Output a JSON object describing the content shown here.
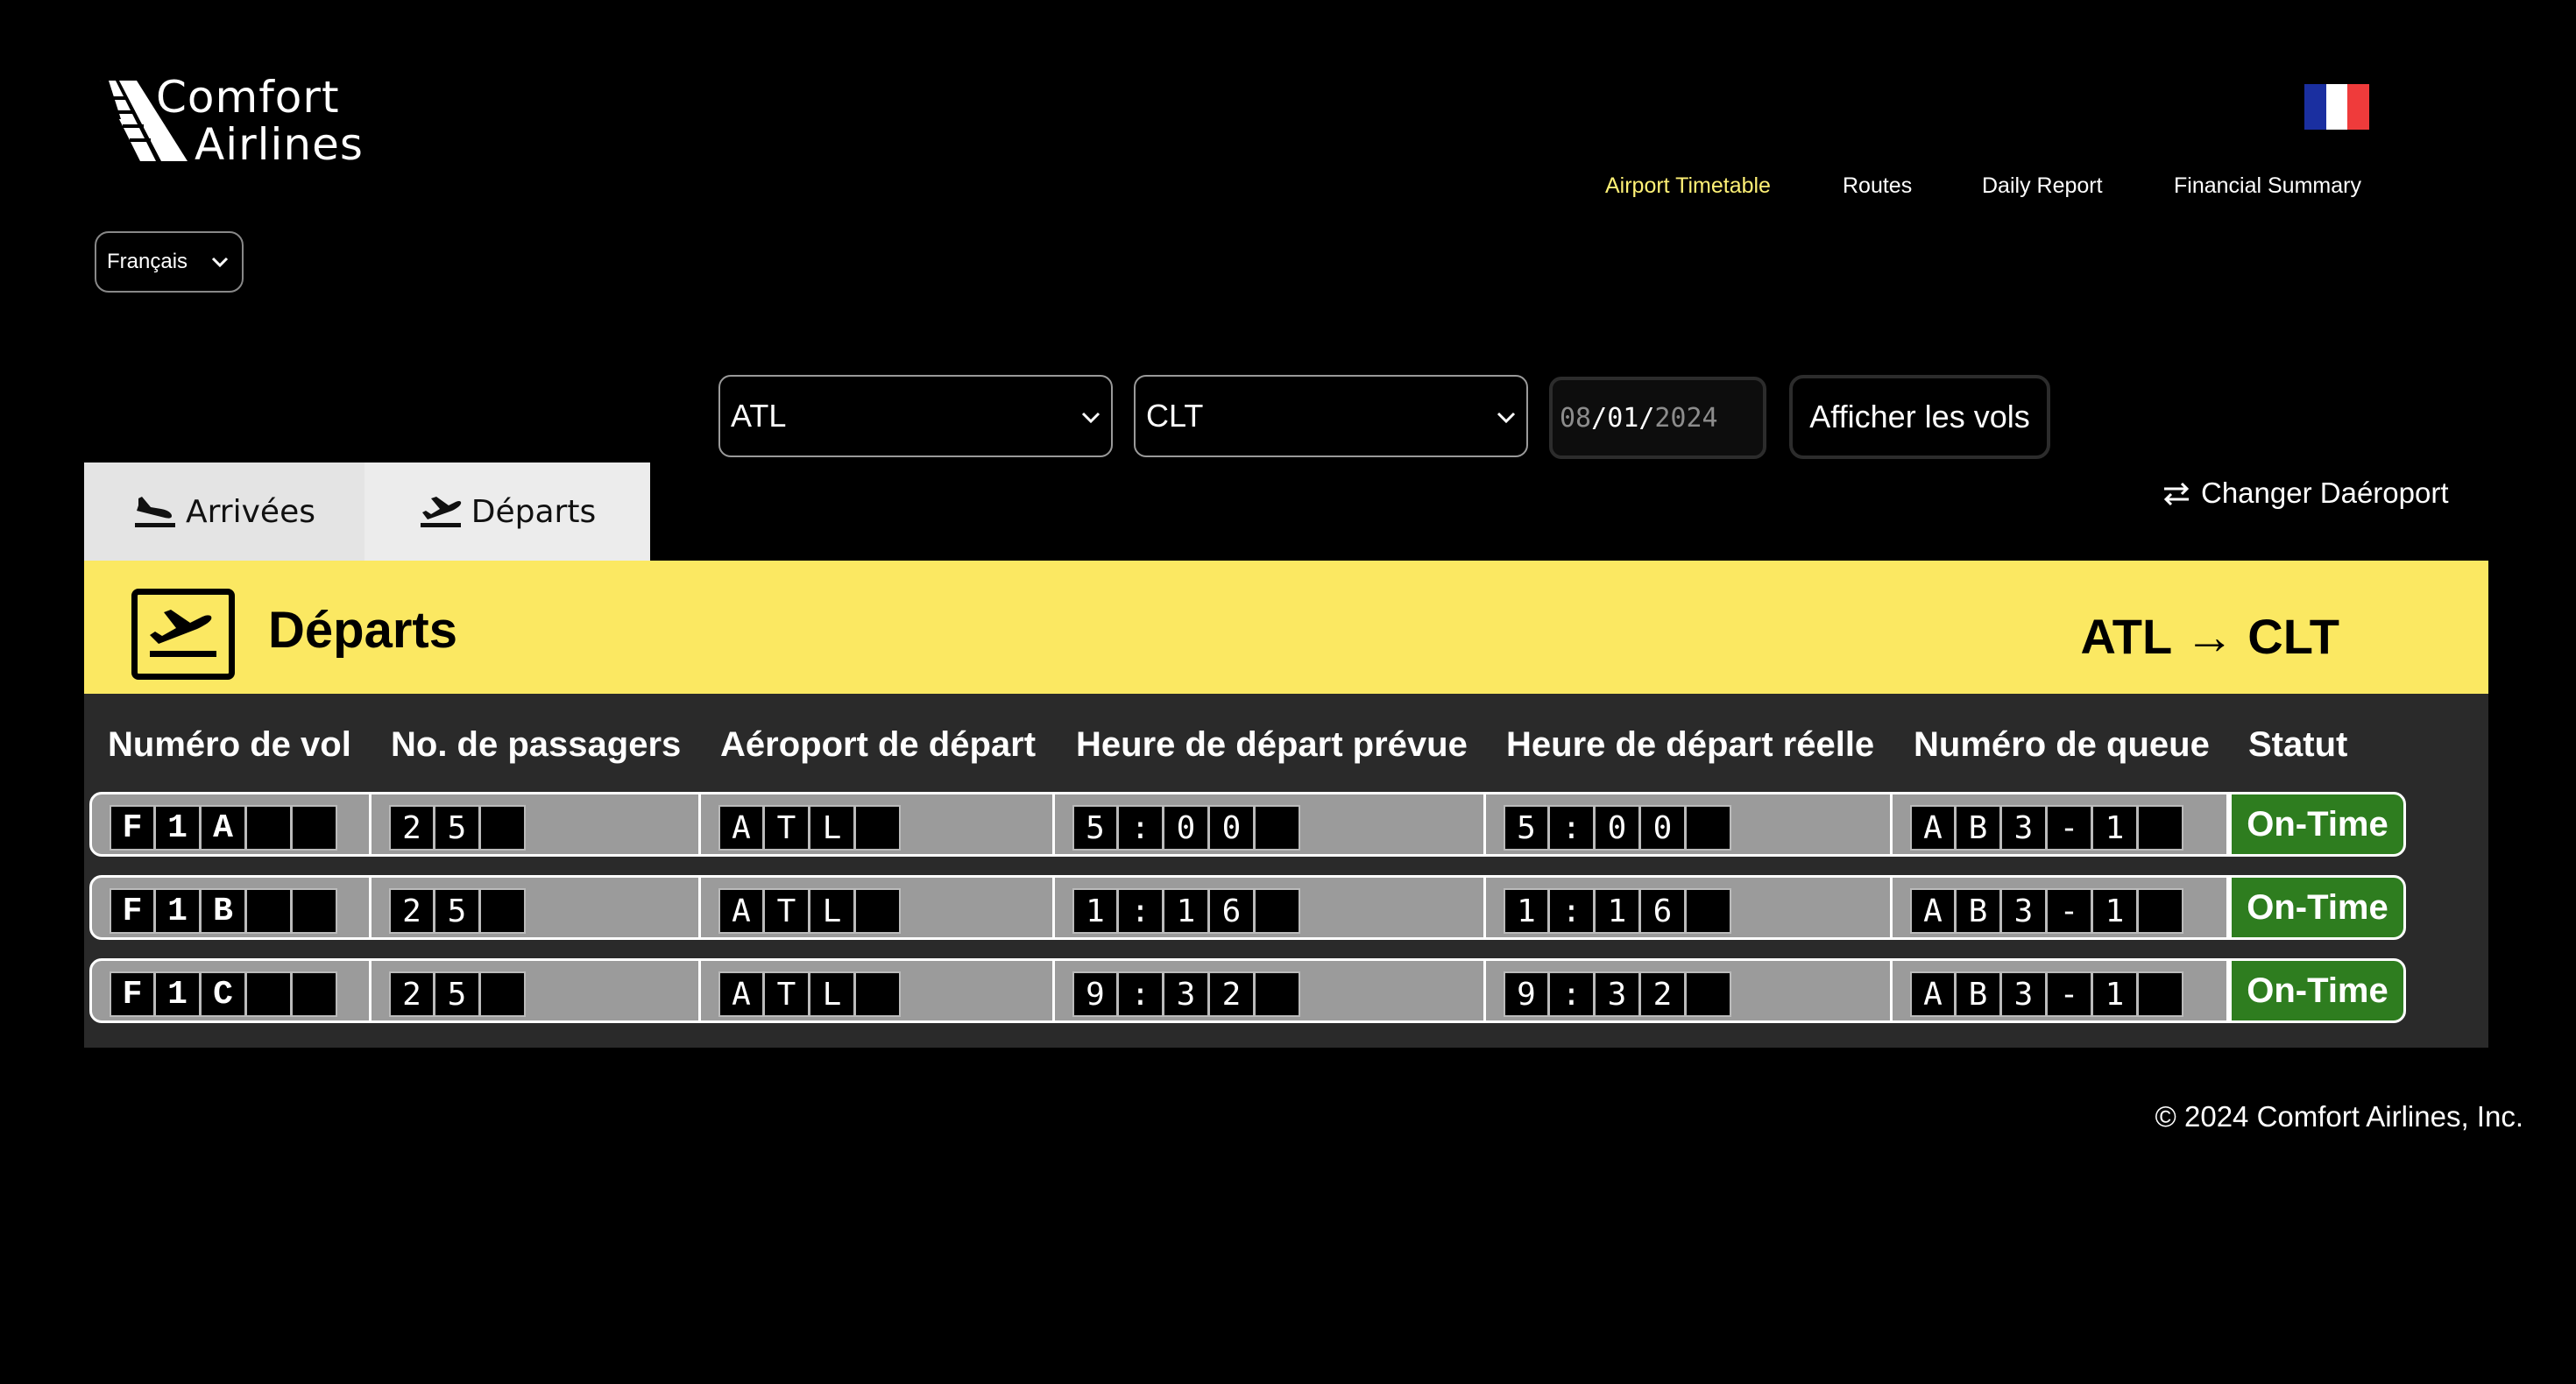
{
  "brand": {
    "line1": "Comfort",
    "line2": "Airlines"
  },
  "nav": {
    "items": [
      {
        "label": "Airport Timetable",
        "active": true
      },
      {
        "label": "Routes",
        "active": false
      },
      {
        "label": "Daily Report",
        "active": false
      },
      {
        "label": "Financial Summary",
        "active": false
      }
    ]
  },
  "language": {
    "value": "Français"
  },
  "filters": {
    "origin": "ATL",
    "destination": "CLT",
    "date_month": "08",
    "date_day": "01",
    "date_year": "2024",
    "submit_label": "Afficher les vols"
  },
  "tabs": {
    "arrivals": "Arrivées",
    "departures": "Départs"
  },
  "change_airport": "Changer Daéroport",
  "board": {
    "title": "Départs",
    "route_from": "ATL",
    "route_arrow": "→",
    "route_to": "CLT",
    "columns": [
      "Numéro de vol",
      "No. de passagers",
      "Aéroport de départ",
      "Heure de départ prévue",
      "Heure de départ réelle",
      "Numéro de queue",
      "Statut"
    ],
    "rows": [
      {
        "flight": "F1A",
        "passengers": "25",
        "airport": "ATL",
        "scheduled": "5:00",
        "actual": "5:00",
        "tail": "AB3-1",
        "status": "On-Time"
      },
      {
        "flight": "F1B",
        "passengers": "25",
        "airport": "ATL",
        "scheduled": "1:16",
        "actual": "1:16",
        "tail": "AB3-1",
        "status": "On-Time"
      },
      {
        "flight": "F1C",
        "passengers": "25",
        "airport": "ATL",
        "scheduled": "9:32",
        "actual": "9:32",
        "tail": "AB3-1",
        "status": "On-Time"
      }
    ]
  },
  "footer": "© 2024 Comfort Airlines, Inc.",
  "colors": {
    "accent_yellow": "#fbe862",
    "nav_active": "#fff176",
    "status_green": "#2e7d1f",
    "flag": [
      "#1a2fa0",
      "#ffffff",
      "#ef3b3b"
    ]
  },
  "icons": [
    "logo-mark-icon",
    "france-flag-icon",
    "chevron-down-icon",
    "plane-landing-icon",
    "plane-takeoff-icon",
    "swap-arrows-icon"
  ]
}
